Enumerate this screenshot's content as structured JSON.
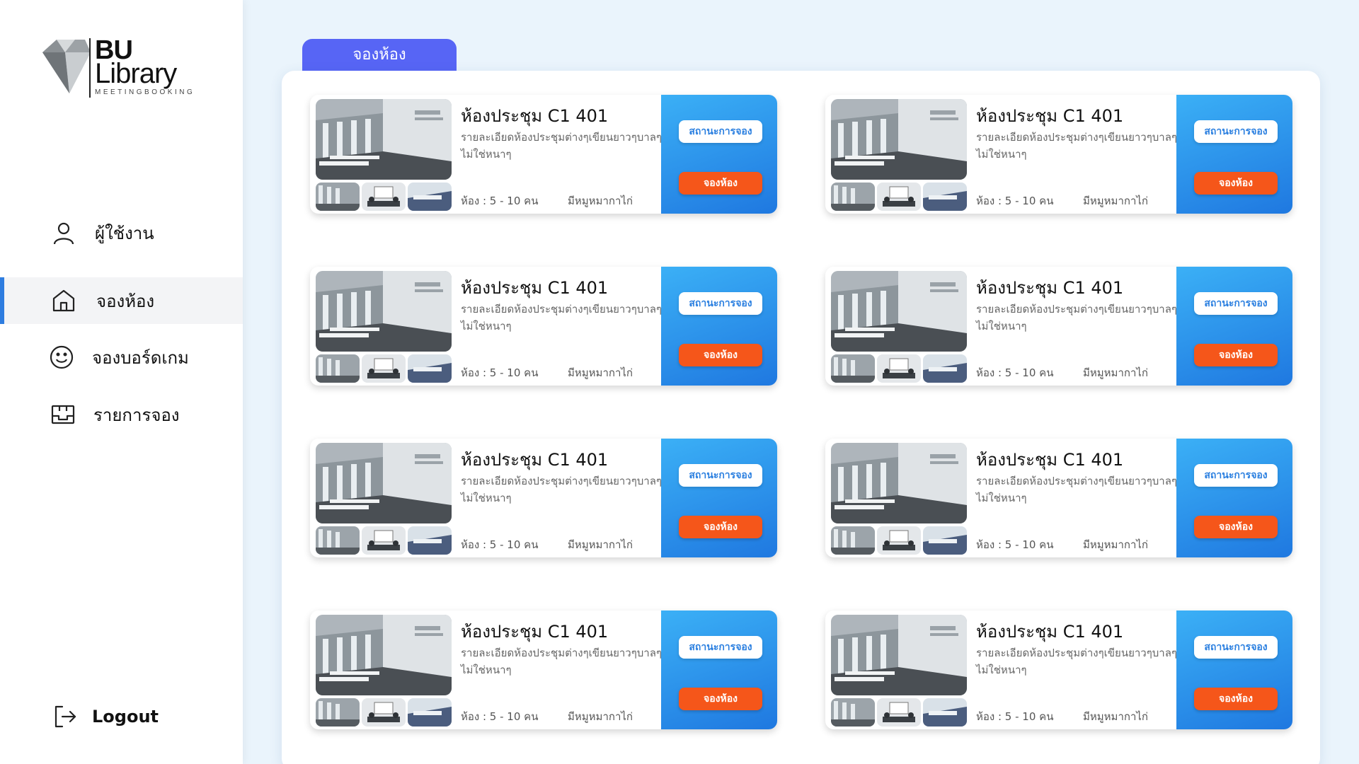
{
  "logo": {
    "line1": "BU",
    "line2": "Library",
    "tagline": "MEETINGBOOKING"
  },
  "sidebar": {
    "items": [
      {
        "label": "ผู้ใช้งาน",
        "icon": "user-icon",
        "active": false
      },
      {
        "label": "จองห้อง",
        "icon": "home-icon",
        "active": true
      },
      {
        "label": "จองบอร์ดเกม",
        "icon": "smiley-icon",
        "active": false
      },
      {
        "label": "รายการจอง",
        "icon": "inbox-icon",
        "active": false
      }
    ],
    "logout": {
      "label": "Logout",
      "icon": "logout-icon"
    }
  },
  "main": {
    "tab_label": "จองห้อง",
    "rooms": [
      {
        "title": "ห้องประชุม C1 401",
        "description": "รายละเอียดห้องประชุมต่างๆเขียนยาวๆบาลๆไม่ใช่หนาๆ",
        "capacity": "ห้อง : 5 - 10 คน",
        "amenity": "มีหมูหมากาไก่",
        "status_label": "สถานะการจอง",
        "book_label": "จองห้อง"
      },
      {
        "title": "ห้องประชุม C1 401",
        "description": "รายละเอียดห้องประชุมต่างๆเขียนยาวๆบาลๆไม่ใช่หนาๆ",
        "capacity": "ห้อง : 5 - 10 คน",
        "amenity": "มีหมูหมากาไก่",
        "status_label": "สถานะการจอง",
        "book_label": "จองห้อง"
      },
      {
        "title": "ห้องประชุม C1 401",
        "description": "รายละเอียดห้องประชุมต่างๆเขียนยาวๆบาลๆไม่ใช่หนาๆ",
        "capacity": "ห้อง : 5 - 10 คน",
        "amenity": "มีหมูหมากาไก่",
        "status_label": "สถานะการจอง",
        "book_label": "จองห้อง"
      },
      {
        "title": "ห้องประชุม C1 401",
        "description": "รายละเอียดห้องประชุมต่างๆเขียนยาวๆบาลๆไม่ใช่หนาๆ",
        "capacity": "ห้อง : 5 - 10 คน",
        "amenity": "มีหมูหมากาไก่",
        "status_label": "สถานะการจอง",
        "book_label": "จองห้อง"
      },
      {
        "title": "ห้องประชุม C1 401",
        "description": "รายละเอียดห้องประชุมต่างๆเขียนยาวๆบาลๆไม่ใช่หนาๆ",
        "capacity": "ห้อง : 5 - 10 คน",
        "amenity": "มีหมูหมากาไก่",
        "status_label": "สถานะการจอง",
        "book_label": "จองห้อง"
      },
      {
        "title": "ห้องประชุม C1 401",
        "description": "รายละเอียดห้องประชุมต่างๆเขียนยาวๆบาลๆไม่ใช่หนาๆ",
        "capacity": "ห้อง : 5 - 10 คน",
        "amenity": "มีหมูหมากาไก่",
        "status_label": "สถานะการจอง",
        "book_label": "จองห้อง"
      },
      {
        "title": "ห้องประชุม C1 401",
        "description": "รายละเอียดห้องประชุมต่างๆเขียนยาวๆบาลๆไม่ใช่หนาๆ",
        "capacity": "ห้อง : 5 - 10 คน",
        "amenity": "มีหมูหมากาไก่",
        "status_label": "สถานะการจอง",
        "book_label": "จองห้อง"
      },
      {
        "title": "ห้องประชุม C1 401",
        "description": "รายละเอียดห้องประชุมต่างๆเขียนยาวๆบาลๆไม่ใช่หนาๆ",
        "capacity": "ห้อง : 5 - 10 คน",
        "amenity": "มีหมูหมากาไก่",
        "status_label": "สถานะการจอง",
        "book_label": "จองห้อง"
      }
    ]
  },
  "colors": {
    "tab": "#5765f5",
    "active_indicator": "#2e7de0",
    "action_panel_top": "#3bb0f6",
    "action_panel_bottom": "#1f78e0",
    "book_button": "#f5561a",
    "status_button_text": "#2a7fe0",
    "page_background": "#eaf4fc"
  }
}
